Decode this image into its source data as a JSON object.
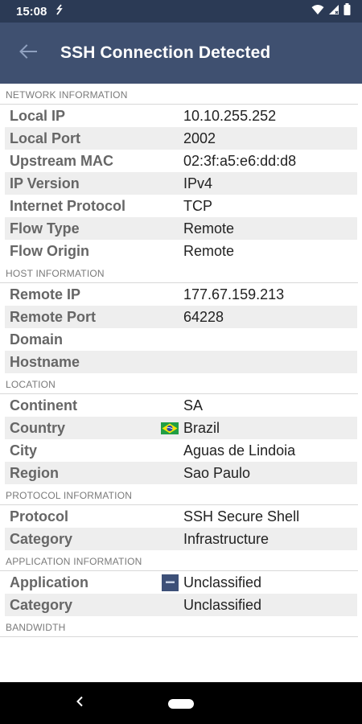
{
  "status_bar": {
    "time": "15:08"
  },
  "app_bar": {
    "title": "SSH Connection Detected"
  },
  "sections": {
    "network": {
      "title": "NETWORK INFORMATION",
      "rows": [
        {
          "label": "Local IP",
          "value": "10.10.255.252"
        },
        {
          "label": "Local Port",
          "value": "2002"
        },
        {
          "label": "Upstream MAC",
          "value": "02:3f:a5:e6:dd:d8"
        },
        {
          "label": "IP Version",
          "value": "IPv4"
        },
        {
          "label": "Internet Protocol",
          "value": "TCP"
        },
        {
          "label": "Flow Type",
          "value": "Remote"
        },
        {
          "label": "Flow Origin",
          "value": "Remote"
        }
      ]
    },
    "host": {
      "title": "HOST INFORMATION",
      "rows": [
        {
          "label": "Remote IP",
          "value": "177.67.159.213"
        },
        {
          "label": "Remote Port",
          "value": "64228"
        },
        {
          "label": "Domain",
          "value": ""
        },
        {
          "label": "Hostname",
          "value": ""
        }
      ]
    },
    "location": {
      "title": "LOCATION",
      "rows": [
        {
          "label": "Continent",
          "value": "SA"
        },
        {
          "label": "Country",
          "value": "Brazil",
          "icon": "brazil-flag-icon"
        },
        {
          "label": "City",
          "value": "Aguas de Lindoia"
        },
        {
          "label": "Region",
          "value": "Sao Paulo"
        }
      ]
    },
    "protocol": {
      "title": "PROTOCOL INFORMATION",
      "rows": [
        {
          "label": "Protocol",
          "value": "SSH Secure Shell"
        },
        {
          "label": "Category",
          "value": "Infrastructure"
        }
      ]
    },
    "application": {
      "title": "APPLICATION INFORMATION",
      "rows": [
        {
          "label": "Application",
          "value": "Unclassified",
          "icon": "unclassified-app-icon"
        },
        {
          "label": "Category",
          "value": "Unclassified"
        }
      ]
    },
    "bandwidth": {
      "title": "BANDWIDTH"
    }
  },
  "colors": {
    "status_bar": "#2b3a55",
    "app_bar": "#3f5070",
    "row_shade": "#eeeeee",
    "label_text": "#666666",
    "value_text": "#222222"
  }
}
